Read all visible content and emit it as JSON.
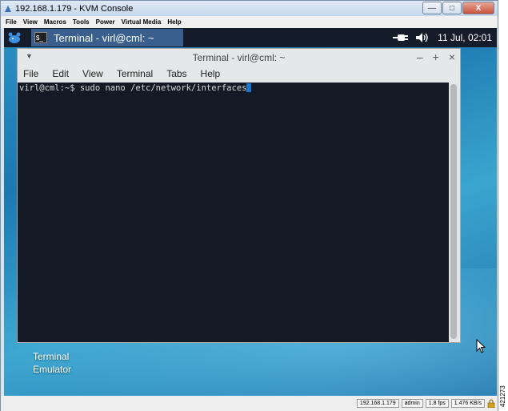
{
  "kvm": {
    "title": "192.168.1.179 - KVM Console",
    "menu": [
      "File",
      "View",
      "Macros",
      "Tools",
      "Power",
      "Virtual Media",
      "Help"
    ],
    "controls": {
      "minimize": "—",
      "maximize": "□",
      "close": "X"
    }
  },
  "taskbar": {
    "task_label": "Terminal - virl@cml: ~",
    "clock": "11 Jul, 02:01"
  },
  "terminal": {
    "title": "Terminal - virl@cml: ~",
    "menu": [
      "File",
      "Edit",
      "View",
      "Terminal",
      "Tabs",
      "Help"
    ],
    "prompt": "virl@cml:~$ sudo nano /etc/network/interfaces",
    "controls": {
      "minimize": "–",
      "maximize": "+",
      "close": "×"
    }
  },
  "desktop_icon": {
    "line1": "Terminal",
    "line2": "Emulator"
  },
  "status": {
    "ip": "192.168.1.179",
    "user": "admin",
    "fps": "1.8 fps",
    "rate": "1.476 KB/s"
  },
  "figure_number": "421273",
  "colors": {
    "taskbar": "#151c2a",
    "task_active": "#3a5f8e",
    "terminal_bg": "#141a25",
    "cursor": "#1d74c8",
    "desktop": "#2b8fc2"
  }
}
